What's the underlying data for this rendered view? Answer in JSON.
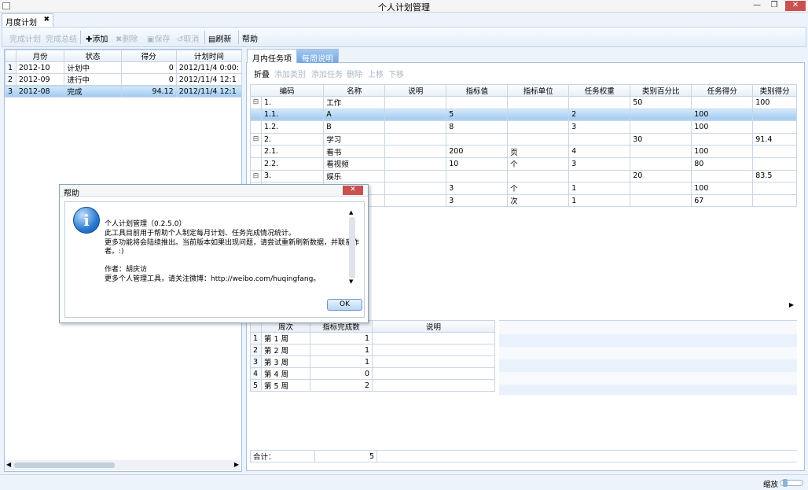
{
  "window": {
    "title": "个人计划管理",
    "minimize": "—",
    "restore": "❐",
    "close": "✕"
  },
  "doc_tab": {
    "label": "月度计划",
    "close": "✖"
  },
  "toolbar": {
    "complete_plan": "完成计划",
    "complete_summary": "完成总结",
    "add": "✚添加",
    "delete": "✖删除",
    "save": "▣保存",
    "cancel": "↺取消",
    "refresh": "▤刷新",
    "help": "帮助"
  },
  "left_grid": {
    "headers": [
      "月份",
      "状态",
      "得分",
      "计划时间"
    ],
    "rows": [
      {
        "idx": "1",
        "month": "2012-10",
        "status": "计划中",
        "score": "0",
        "time": "2012/11/4 0:00:"
      },
      {
        "idx": "2",
        "month": "2012-09",
        "status": "进行中",
        "score": "0",
        "time": "2012/11/4 12:1"
      },
      {
        "idx": "3",
        "month": "2012-08",
        "status": "完成",
        "score": "94.12",
        "time": "2012/11/4 12:1"
      }
    ]
  },
  "right_tabs": {
    "monthly": "月内任务项",
    "weekly": "每周说明"
  },
  "sub_toolbar": {
    "collapse": "折叠",
    "add_category": "添加类别",
    "add_task": "添加任务",
    "delete": "删除",
    "up": "上移",
    "down": "下移"
  },
  "task_grid": {
    "headers": [
      "编码",
      "名称",
      "说明",
      "指标值",
      "指标单位",
      "任务权重",
      "类别百分比",
      "任务得分",
      "类别得分"
    ],
    "rows": [
      {
        "tree": "⊟",
        "code": "1.",
        "name": "工作",
        "desc": "",
        "value": "",
        "unit": "",
        "weight": "",
        "pct": "50",
        "score": "",
        "cat": "100"
      },
      {
        "tree": "",
        "code": "1.1.",
        "name": "A",
        "desc": "",
        "value": "5",
        "unit": "",
        "weight": "2",
        "pct": "",
        "score": "100",
        "cat": ""
      },
      {
        "tree": "",
        "code": "1.2.",
        "name": "B",
        "desc": "",
        "value": "8",
        "unit": "",
        "weight": "3",
        "pct": "",
        "score": "100",
        "cat": ""
      },
      {
        "tree": "⊟",
        "code": "2.",
        "name": "学习",
        "desc": "",
        "value": "",
        "unit": "",
        "weight": "",
        "pct": "30",
        "score": "",
        "cat": "91.4"
      },
      {
        "tree": "",
        "code": "2.1.",
        "name": "看书",
        "desc": "",
        "value": "200",
        "unit": "页",
        "weight": "4",
        "pct": "",
        "score": "100",
        "cat": ""
      },
      {
        "tree": "",
        "code": "2.2.",
        "name": "看视频",
        "desc": "",
        "value": "10",
        "unit": "个",
        "weight": "3",
        "pct": "",
        "score": "80",
        "cat": ""
      },
      {
        "tree": "⊟",
        "code": "3.",
        "name": "娱乐",
        "desc": "",
        "value": "",
        "unit": "",
        "weight": "",
        "pct": "20",
        "score": "",
        "cat": "83.5"
      },
      {
        "tree": "",
        "code": "",
        "name": "",
        "desc": "",
        "value": "3",
        "unit": "个",
        "weight": "1",
        "pct": "",
        "score": "100",
        "cat": ""
      },
      {
        "tree": "",
        "code": "",
        "name": "",
        "desc": "",
        "value": "3",
        "unit": "次",
        "weight": "1",
        "pct": "",
        "score": "67",
        "cat": ""
      }
    ]
  },
  "week_grid": {
    "headers": [
      "周次",
      "指标完成数",
      "说明"
    ],
    "rows": [
      {
        "idx": "1",
        "week": "第 1 周",
        "count": "1",
        "note": ""
      },
      {
        "idx": "2",
        "week": "第 2 周",
        "count": "1",
        "note": ""
      },
      {
        "idx": "3",
        "week": "第 3 周",
        "count": "1",
        "note": ""
      },
      {
        "idx": "4",
        "week": "第 4 周",
        "count": "0",
        "note": ""
      },
      {
        "idx": "5",
        "week": "第 5 周",
        "count": "2",
        "note": ""
      }
    ],
    "total_label": "合计：",
    "total_value": "5"
  },
  "status_bar": {
    "zoom_label": "缩放"
  },
  "dialog": {
    "title": "帮助",
    "close": "✕",
    "icon": "info-icon",
    "lines": [
      "个人计划管理（0.2.5.0）",
      "此工具目前用于帮助个人制定每月计划、任务完成情况统计。",
      "更多功能将会陆续推出。当前版本如果出现问题，请尝试重新刷新数据，并联系作",
      "者。:)",
      "作者：胡庆访",
      "更多个人管理工具，请关注微博：http://weibo.com/huqingfang。"
    ],
    "ok": "OK"
  }
}
